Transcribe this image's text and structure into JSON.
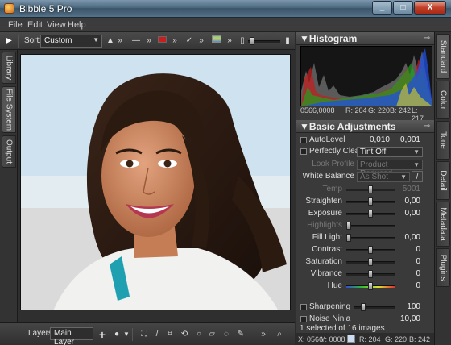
{
  "window": {
    "title": "Bibble 5 Pro",
    "minimize": "_",
    "maximize": "□",
    "close": "X"
  },
  "menu": [
    "File",
    "Edit",
    "View",
    "Help"
  ],
  "toolbar": {
    "sort_label": "Sort:",
    "sort_value": "Custom"
  },
  "left_tabs": [
    "Library",
    "File System",
    "Output"
  ],
  "bottombar": {
    "layers_label": "Layers",
    "layer_value": "Main Layer"
  },
  "histogram": {
    "title": "Histogram",
    "coords": "0566,0008",
    "r": "R: 204",
    "g": "G: 220",
    "b": "B: 242",
    "l": "L: 217"
  },
  "basic": {
    "title": "Basic Adjustments",
    "autolevel_label": "AutoLevel",
    "autolevel_v1": "0,010",
    "autolevel_v2": "0,001",
    "perfectly_clear_label": "Perfectly Clear",
    "perfectly_clear_value": "Tint Off",
    "look_profile_label": "Look Profile",
    "look_profile_value": "Product Reduced",
    "white_balance_label": "White Balance",
    "white_balance_value": "As Shot",
    "rows": [
      {
        "label": "Temp",
        "value": "5001",
        "level": 0.5,
        "dim": true
      },
      {
        "label": "Straighten",
        "value": "0,00",
        "level": 0.5
      },
      {
        "label": "Exposure",
        "value": "0,00",
        "level": 0.5
      },
      {
        "label": "Highlights",
        "value": "",
        "level": 0.0,
        "dim": true
      },
      {
        "label": "Fill Light",
        "value": "0,00",
        "level": 0.0
      },
      {
        "label": "Contrast",
        "value": "0",
        "level": 0.5
      },
      {
        "label": "Saturation",
        "value": "0",
        "level": 0.5
      },
      {
        "label": "Vibrance",
        "value": "0",
        "level": 0.5
      },
      {
        "label": "Hue",
        "value": "0",
        "level": 0.5,
        "color": true
      }
    ],
    "sharpening_label": "Sharpening",
    "sharpening_value": "100",
    "noise_label": "Noise Ninja",
    "noise_value": "10,00"
  },
  "status": "1 selected of 16 images",
  "coords": {
    "x": "X: 0566",
    "y": "Y: 0008",
    "r": "R: 204",
    "g": "G: 220",
    "b": "B: 242"
  },
  "right_tabs": [
    "Standard",
    "Color",
    "Tone",
    "Detail",
    "Metadata",
    "Plugins"
  ],
  "colors": {
    "accent": "#4e6a80",
    "close": "#c0402a"
  }
}
